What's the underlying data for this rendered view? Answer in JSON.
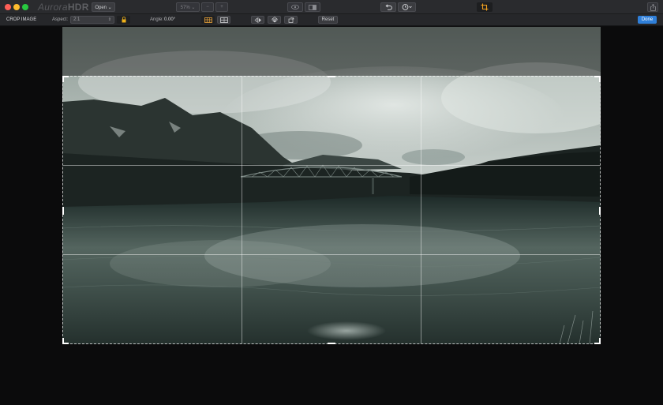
{
  "app": {
    "logo_prefix": "Aurora",
    "logo_suffix": "HDR"
  },
  "titlebar": {
    "open_label": "Open ⌄",
    "zoom_value": "57% ⌄",
    "zoom_out": "−",
    "zoom_in": "+"
  },
  "toolbar": {
    "section_title": "CROP IMAGE",
    "aspect_label": "Aspect:",
    "aspect_value": "2:1",
    "angle_label": "Angle:",
    "angle_value": "0.00°",
    "reset_label": "Reset",
    "done_label": "Done"
  },
  "colors": {
    "accent": "#2f7fd9",
    "lock": "#f0b21a",
    "grid_active": "#e8a23a",
    "crop_tool": "#f0a020"
  },
  "icons": [
    "eye-icon",
    "compare-icon",
    "undo-icon",
    "history-icon",
    "crop-icon",
    "share-icon",
    "lock-icon",
    "grid-icon",
    "thirds-grid-icon",
    "flip-horizontal-icon",
    "flip-vertical-icon",
    "rotate-icon"
  ]
}
